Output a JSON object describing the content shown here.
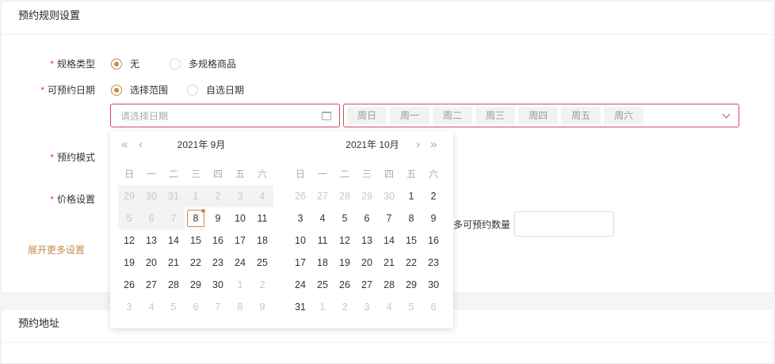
{
  "section1": {
    "title": "预约规则设置"
  },
  "section2": {
    "title": "预约地址"
  },
  "form": {
    "spec_type": {
      "label": "规格类型",
      "options": [
        "无",
        "多规格商品"
      ]
    },
    "date": {
      "label": "可预约日期",
      "options": [
        "选择范围",
        "自选日期"
      ]
    },
    "mode": {
      "label": "预约模式"
    },
    "price": {
      "label": "价格设置"
    },
    "expand": "展开更多设置",
    "max_qty_label": "多可预约数量"
  },
  "date_input": {
    "placeholder": "请选择日期"
  },
  "weekdays_select": [
    "周日",
    "周一",
    "周二",
    "周三",
    "周四",
    "周五",
    "周六"
  ],
  "calendar": {
    "weekday_headers": [
      "日",
      "一",
      "二",
      "三",
      "四",
      "五",
      "六"
    ],
    "left": {
      "title": "2021年 9月",
      "days": [
        {
          "d": "29",
          "s": "dis"
        },
        {
          "d": "30",
          "s": "dis"
        },
        {
          "d": "31",
          "s": "dis"
        },
        {
          "d": "1",
          "s": "dis"
        },
        {
          "d": "2",
          "s": "dis"
        },
        {
          "d": "3",
          "s": "dis"
        },
        {
          "d": "4",
          "s": "dis"
        },
        {
          "d": "5",
          "s": "dis"
        },
        {
          "d": "6",
          "s": "dis"
        },
        {
          "d": "7",
          "s": "dis"
        },
        {
          "d": "8",
          "s": "today"
        },
        {
          "d": "9",
          "s": ""
        },
        {
          "d": "10",
          "s": ""
        },
        {
          "d": "11",
          "s": ""
        },
        {
          "d": "12",
          "s": ""
        },
        {
          "d": "13",
          "s": ""
        },
        {
          "d": "14",
          "s": ""
        },
        {
          "d": "15",
          "s": ""
        },
        {
          "d": "16",
          "s": ""
        },
        {
          "d": "17",
          "s": ""
        },
        {
          "d": "18",
          "s": ""
        },
        {
          "d": "19",
          "s": ""
        },
        {
          "d": "20",
          "s": ""
        },
        {
          "d": "21",
          "s": ""
        },
        {
          "d": "22",
          "s": ""
        },
        {
          "d": "23",
          "s": ""
        },
        {
          "d": "24",
          "s": ""
        },
        {
          "d": "25",
          "s": ""
        },
        {
          "d": "26",
          "s": ""
        },
        {
          "d": "27",
          "s": ""
        },
        {
          "d": "28",
          "s": ""
        },
        {
          "d": "29",
          "s": ""
        },
        {
          "d": "30",
          "s": ""
        },
        {
          "d": "1",
          "s": "dim"
        },
        {
          "d": "2",
          "s": "dim"
        },
        {
          "d": "3",
          "s": "dim"
        },
        {
          "d": "4",
          "s": "dim"
        },
        {
          "d": "5",
          "s": "dim"
        },
        {
          "d": "6",
          "s": "dim"
        },
        {
          "d": "7",
          "s": "dim"
        },
        {
          "d": "8",
          "s": "dim"
        },
        {
          "d": "9",
          "s": "dim"
        }
      ]
    },
    "right": {
      "title": "2021年 10月",
      "days": [
        {
          "d": "26",
          "s": "dim"
        },
        {
          "d": "27",
          "s": "dim"
        },
        {
          "d": "28",
          "s": "dim"
        },
        {
          "d": "29",
          "s": "dim"
        },
        {
          "d": "30",
          "s": "dim"
        },
        {
          "d": "1",
          "s": ""
        },
        {
          "d": "2",
          "s": ""
        },
        {
          "d": "3",
          "s": ""
        },
        {
          "d": "4",
          "s": ""
        },
        {
          "d": "5",
          "s": ""
        },
        {
          "d": "6",
          "s": ""
        },
        {
          "d": "7",
          "s": ""
        },
        {
          "d": "8",
          "s": ""
        },
        {
          "d": "9",
          "s": ""
        },
        {
          "d": "10",
          "s": ""
        },
        {
          "d": "11",
          "s": ""
        },
        {
          "d": "12",
          "s": ""
        },
        {
          "d": "13",
          "s": ""
        },
        {
          "d": "14",
          "s": ""
        },
        {
          "d": "15",
          "s": ""
        },
        {
          "d": "16",
          "s": ""
        },
        {
          "d": "17",
          "s": ""
        },
        {
          "d": "18",
          "s": ""
        },
        {
          "d": "19",
          "s": ""
        },
        {
          "d": "20",
          "s": ""
        },
        {
          "d": "21",
          "s": ""
        },
        {
          "d": "22",
          "s": ""
        },
        {
          "d": "23",
          "s": ""
        },
        {
          "d": "24",
          "s": ""
        },
        {
          "d": "25",
          "s": ""
        },
        {
          "d": "26",
          "s": ""
        },
        {
          "d": "27",
          "s": ""
        },
        {
          "d": "28",
          "s": ""
        },
        {
          "d": "29",
          "s": ""
        },
        {
          "d": "30",
          "s": ""
        },
        {
          "d": "31",
          "s": ""
        },
        {
          "d": "1",
          "s": "dim"
        },
        {
          "d": "2",
          "s": "dim"
        },
        {
          "d": "3",
          "s": "dim"
        },
        {
          "d": "4",
          "s": "dim"
        },
        {
          "d": "5",
          "s": "dim"
        },
        {
          "d": "6",
          "s": "dim"
        }
      ]
    }
  },
  "icons": {
    "calendar": "calendar-icon",
    "prev_year": "«",
    "prev_month": "‹",
    "next_month": "›",
    "next_year": "»"
  },
  "colors": {
    "accent": "#c98a4b",
    "error": "#d5485c",
    "required": "#e03a3a"
  }
}
